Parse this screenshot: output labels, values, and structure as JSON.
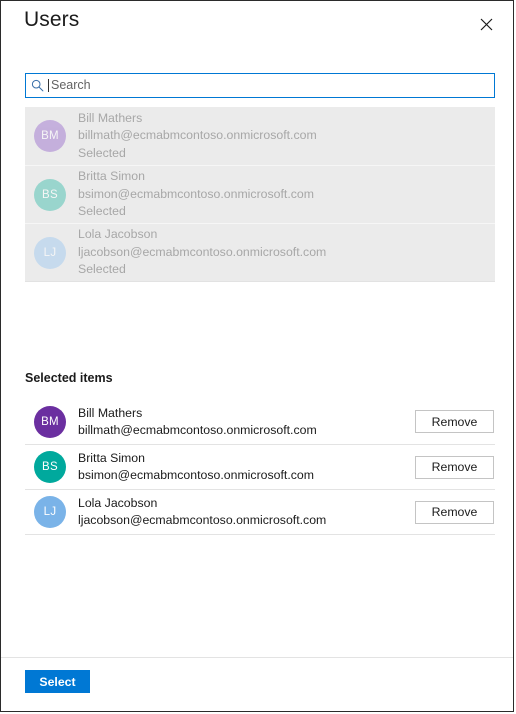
{
  "panel": {
    "title": "Users",
    "close_icon": "close-icon"
  },
  "search": {
    "icon": "search-icon",
    "placeholder": "Search",
    "value": ""
  },
  "results": {
    "items": [
      {
        "initials": "BM",
        "name": "Bill Mathers",
        "email": "billmath@ecmabmcontoso.onmicrosoft.com",
        "status": "Selected",
        "color": "#a67fd1"
      },
      {
        "initials": "BS",
        "name": "Britta Simon",
        "email": "bsimon@ecmabmcontoso.onmicrosoft.com",
        "status": "Selected",
        "color": "#57c4b5"
      },
      {
        "initials": "LJ",
        "name": "Lola Jacobson",
        "email": "ljacobson@ecmabmcontoso.onmicrosoft.com",
        "status": "Selected",
        "color": "#a8cdf0"
      }
    ]
  },
  "selected": {
    "heading": "Selected items",
    "items": [
      {
        "initials": "BM",
        "name": "Bill Mathers",
        "email": "billmath@ecmabmcontoso.onmicrosoft.com",
        "remove_label": "Remove",
        "color": "#6b2fa0"
      },
      {
        "initials": "BS",
        "name": "Britta Simon",
        "email": "bsimon@ecmabmcontoso.onmicrosoft.com",
        "remove_label": "Remove",
        "color": "#00a99d"
      },
      {
        "initials": "LJ",
        "name": "Lola Jacobson",
        "email": "ljacobson@ecmabmcontoso.onmicrosoft.com",
        "remove_label": "Remove",
        "color": "#7ab3e8"
      }
    ]
  },
  "footer": {
    "select_label": "Select",
    "accent_color": "#0078d4"
  }
}
